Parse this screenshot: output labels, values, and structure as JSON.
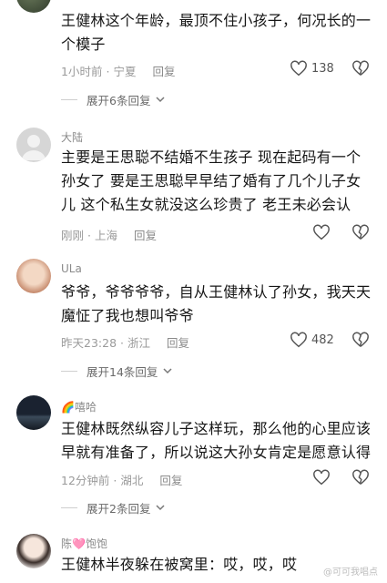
{
  "comments": [
    {
      "username": "",
      "text": "王健林这个年龄，最顶不住小孩子，何况长的一个模子",
      "time": "1小时前",
      "location": "宁夏",
      "reply_label": "回复",
      "likes": "138",
      "expand_label": "展开6条回复"
    },
    {
      "username": "大陆",
      "text": "主要是王思聪不结婚不生孩子 现在起码有一个孙女了 要是王思聪早早结了婚有了几个儿子女儿 这个私生女就没这么珍贵了 老王未必会认",
      "time": "刚刚",
      "location": "上海",
      "reply_label": "回复",
      "likes": "",
      "expand_label": ""
    },
    {
      "username": "ULa",
      "text": "爷爷，爷爷爷爷，自从王健林认了孙女，我天天魔怔了我也想叫爷爷",
      "time": "昨天23:28",
      "location": "浙江",
      "reply_label": "回复",
      "likes": "482",
      "expand_label": "展开14条回复"
    },
    {
      "username": "🌈嘻哈",
      "text": "王健林既然纵容儿子这样玩，那么他的心里应该早就有准备了，所以说这大孙女肯定是愿意认得",
      "time": "12分钟前",
      "location": "湖北",
      "reply_label": "回复",
      "likes": "",
      "expand_label": "展开2条回复"
    },
    {
      "username": "陈🩷饱饱",
      "text": "王健林半夜躲在被窝里：哎，哎，哎",
      "time": "",
      "location": "",
      "reply_label": "",
      "likes": "",
      "expand_label": ""
    }
  ],
  "watermark": "@可可我唱点",
  "icons": {
    "like": "heart-outline-icon",
    "dislike": "broken-heart-icon",
    "expand": "chevron-down-icon"
  }
}
